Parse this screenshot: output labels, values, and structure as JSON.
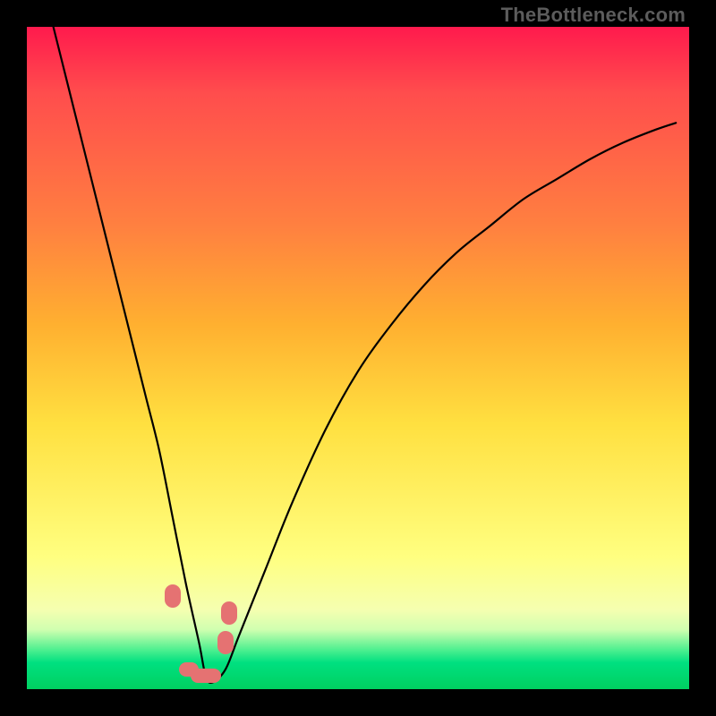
{
  "watermark": "TheBottleneck.com",
  "colors": {
    "gradient_top": "#ff1a4d",
    "gradient_mid": "#ffe040",
    "gradient_bottom": "#00d060",
    "curve": "#000000",
    "marker": "#e57272",
    "frame_bg": "#000000"
  },
  "chart_data": {
    "type": "line",
    "title": "",
    "xlabel": "",
    "ylabel": "",
    "xlim": [
      0,
      100
    ],
    "ylim": [
      0,
      100
    ],
    "note": "x and y normalized to percent of plot-area; y=0 is bottom, y=100 is top. Curve visually depicts a bottleneck V-shape: steep descent on the left, minimum near x≈27, asymptotic rise on the right.",
    "x": [
      4,
      6,
      8,
      10,
      12,
      14,
      16,
      18,
      20,
      22,
      24,
      26,
      27,
      28,
      30,
      32,
      36,
      40,
      45,
      50,
      55,
      60,
      65,
      70,
      75,
      80,
      85,
      90,
      95,
      98
    ],
    "values": [
      100,
      92,
      84,
      76,
      68,
      60,
      52,
      44,
      36,
      26,
      16,
      7,
      2,
      1,
      3,
      8,
      18,
      28,
      39,
      48,
      55,
      61,
      66,
      70,
      74,
      77,
      80,
      82.5,
      84.5,
      85.5
    ],
    "markers": [
      {
        "x": 22.0,
        "y": 14.0,
        "shape": "pill-vertical"
      },
      {
        "x": 24.5,
        "y": 3.0,
        "shape": "pill-horizontal-short"
      },
      {
        "x": 27.0,
        "y": 2.0,
        "shape": "pill-horizontal"
      },
      {
        "x": 30.0,
        "y": 7.0,
        "shape": "pill-vertical"
      },
      {
        "x": 30.5,
        "y": 11.5,
        "shape": "pill-vertical"
      }
    ]
  }
}
